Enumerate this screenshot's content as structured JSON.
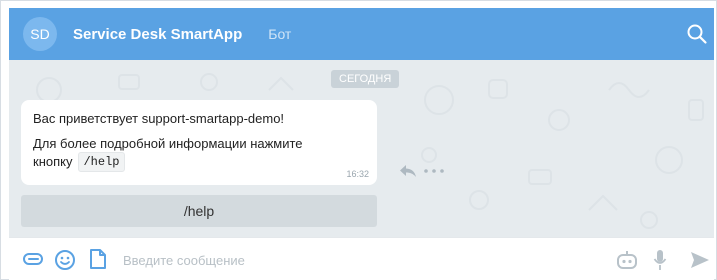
{
  "header": {
    "avatar_initials": "SD",
    "title": "Service Desk SmartApp",
    "subtitle": "Бот",
    "search_icon": "search-icon"
  },
  "chat": {
    "date_label": "СЕГОДНЯ",
    "message": {
      "line1": "Вас приветствует support-smartapp-demo!",
      "line2": "Для более подробной информации нажмите",
      "line3_prefix": "кнопку",
      "command": "/help",
      "time": "16:32"
    },
    "actions": {
      "reply_icon": "reply-arrow-icon",
      "more_icon": "more-dots-icon"
    },
    "keyboard_button": "/help"
  },
  "composer": {
    "placeholder": "Введите сообщение",
    "icons": [
      "attach-icon",
      "emoji-icon",
      "file-icon",
      "bot-icon",
      "microphone-icon",
      "send-icon"
    ]
  },
  "colors": {
    "header": "#5aa2e3",
    "chat_background": "#e6ebee",
    "bubble": "#ffffff",
    "icon_blue": "#5aa2e3",
    "icon_grey": "#b8c2c9"
  }
}
